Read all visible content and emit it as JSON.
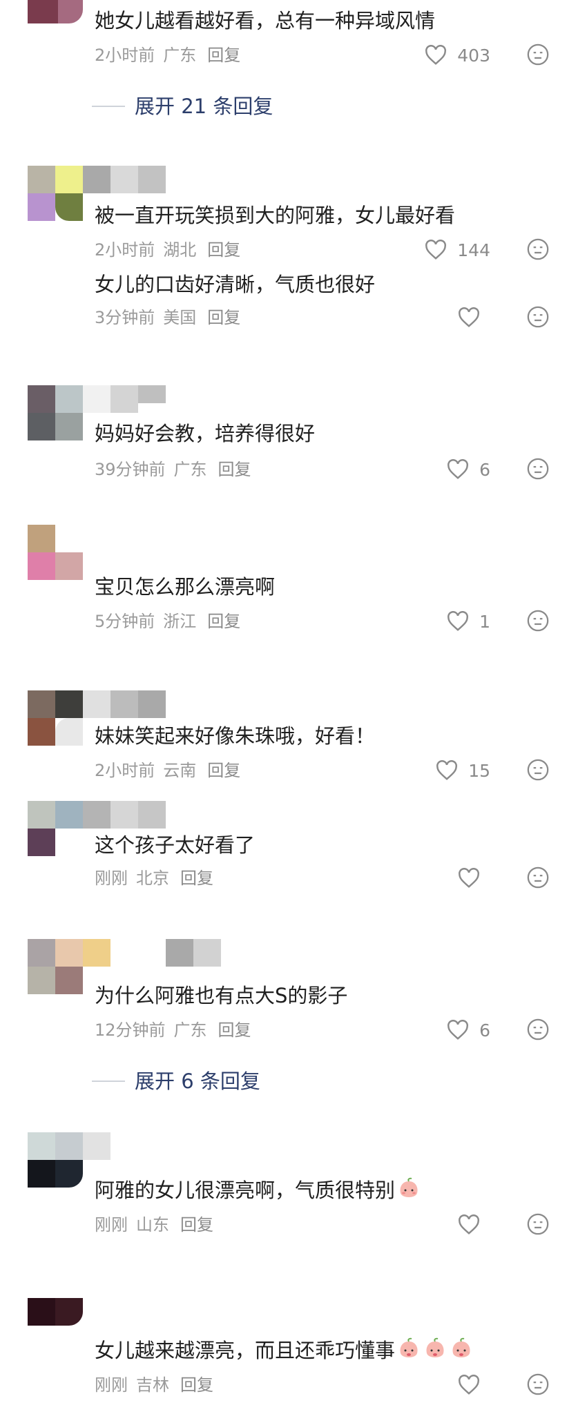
{
  "comments": [
    {
      "text": "她女儿越看越好看，总有一种异域风情",
      "time": "2小时前",
      "location": "广东",
      "reply": "回复",
      "likes": "403"
    },
    {
      "text": "被一直开玩笑损到大的阿雅，女儿最好看",
      "time": "2小时前",
      "location": "湖北",
      "reply": "回复",
      "likes": "144"
    },
    {
      "text": "女儿的口齿好清晰，气质也很好",
      "time": "3分钟前",
      "location": "美国",
      "reply": "回复",
      "likes": ""
    },
    {
      "text": "妈妈好会教，培养得很好",
      "time": "39分钟前",
      "location": "广东",
      "reply": "回复",
      "likes": "6"
    },
    {
      "text": "宝贝怎么那么漂亮啊",
      "time": "5分钟前",
      "location": "浙江",
      "reply": "回复",
      "likes": "1"
    },
    {
      "text": "妹妹笑起来好像朱珠哦，好看！",
      "time": "2小时前",
      "location": "云南",
      "reply": "回复",
      "likes": "15"
    },
    {
      "text": "这个孩子太好看了",
      "time": "刚刚",
      "location": "北京",
      "reply": "回复",
      "likes": ""
    },
    {
      "text": "为什么阿雅也有点大S的影子",
      "time": "12分钟前",
      "location": "广东",
      "reply": "回复",
      "likes": "6"
    },
    {
      "text": "阿雅的女儿很漂亮啊，气质很特别",
      "time": "刚刚",
      "location": "山东",
      "reply": "回复",
      "likes": ""
    },
    {
      "text": "女儿越来越漂亮，而且还乖巧懂事",
      "time": "刚刚",
      "location": "吉林",
      "reply": "回复",
      "likes": ""
    }
  ],
  "expand_replies": [
    {
      "label": "展开 21 条回复"
    },
    {
      "label": "展开 6 条回复"
    }
  ],
  "colors": {
    "link": "#2c3e6b",
    "meta": "#9a9a9a",
    "text": "#1f1f1f"
  },
  "icons": {
    "like": "heart-icon",
    "dislike": "unhappy-face-icon",
    "emoji": "peach-emoji-icon"
  }
}
